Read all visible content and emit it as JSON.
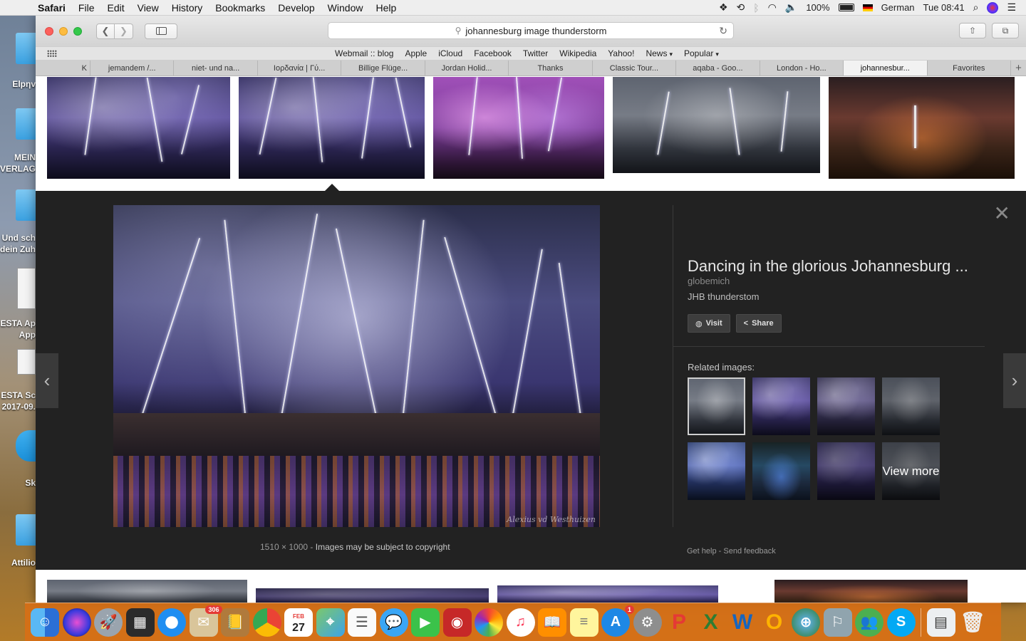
{
  "menubar": {
    "app_name": "Safari",
    "items": [
      "File",
      "Edit",
      "View",
      "History",
      "Bookmarks",
      "Develop",
      "Window",
      "Help"
    ],
    "battery": "100%",
    "input_source": "German",
    "clock": "Tue 08:41"
  },
  "desktop": {
    "labels": [
      "Elpηv",
      "MEIN",
      "VERLAG.",
      "Und sch",
      "dein Zuh.",
      "ESTA Ap",
      "App",
      "ESTA Sc",
      "2017-09.",
      "Sk",
      "Attilio"
    ]
  },
  "browser": {
    "address": "johannesburg image thunderstorm",
    "favorites": [
      "Webmail :: blog",
      "Apple",
      "iCloud",
      "Facebook",
      "Twitter",
      "Wikipedia",
      "Yahoo!",
      "News",
      "Popular"
    ],
    "tabs": [
      "K",
      "jemandem /...",
      "niet- und na...",
      "Ιορδανία | Γύ...",
      "Billige Flüge...",
      "Jordan Holid...",
      "Thanks",
      "Classic Tour...",
      "aqaba - Goo...",
      "London - Ho...",
      "johannesbur...",
      "Favorites"
    ],
    "active_tab_index": 10
  },
  "preview": {
    "title": "Dancing in the glorious Johannesburg ...",
    "source": "globemich",
    "description": "JHB thunderstom",
    "visit_label": "Visit",
    "share_label": "Share",
    "dimensions": "1510 × 1000",
    "separator": "-",
    "copyright": "Images may be subject to copyright",
    "watermark": "Alexius vd Westhuizen",
    "related_label": "Related images:",
    "view_more": "View more",
    "get_help": "Get help",
    "send_feedback": "Send feedback"
  },
  "dock": {
    "mail_badge": "306",
    "calendar_month": "FEB",
    "calendar_day": "27",
    "appstore_badge": "1"
  }
}
